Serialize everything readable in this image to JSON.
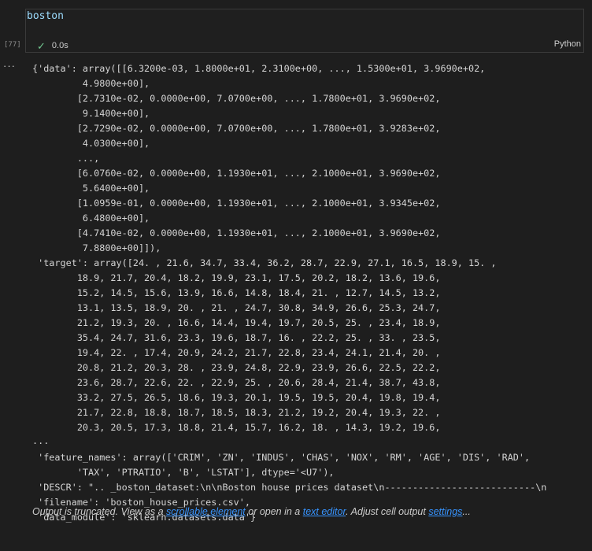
{
  "cell": {
    "code": "boston",
    "exec_count": "[77]",
    "duration": "0.0s",
    "language": "Python"
  },
  "output_menu_label": "···",
  "output_lines": [
    "{'data': array([[6.3200e-03, 1.8000e+01, 2.3100e+00, ..., 1.5300e+01, 3.9690e+02,",
    "         4.9800e+00],",
    "        [2.7310e-02, 0.0000e+00, 7.0700e+00, ..., 1.7800e+01, 3.9690e+02,",
    "         9.1400e+00],",
    "        [2.7290e-02, 0.0000e+00, 7.0700e+00, ..., 1.7800e+01, 3.9283e+02,",
    "         4.0300e+00],",
    "        ...,",
    "        [6.0760e-02, 0.0000e+00, 1.1930e+01, ..., 2.1000e+01, 3.9690e+02,",
    "         5.6400e+00],",
    "        [1.0959e-01, 0.0000e+00, 1.1930e+01, ..., 2.1000e+01, 3.9345e+02,",
    "         6.4800e+00],",
    "        [4.7410e-02, 0.0000e+00, 1.1930e+01, ..., 2.1000e+01, 3.9690e+02,",
    "         7.8800e+00]]),",
    " 'target': array([24. , 21.6, 34.7, 33.4, 36.2, 28.7, 22.9, 27.1, 16.5, 18.9, 15. ,",
    "        18.9, 21.7, 20.4, 18.2, 19.9, 23.1, 17.5, 20.2, 18.2, 13.6, 19.6,",
    "        15.2, 14.5, 15.6, 13.9, 16.6, 14.8, 18.4, 21. , 12.7, 14.5, 13.2,",
    "        13.1, 13.5, 18.9, 20. , 21. , 24.7, 30.8, 34.9, 26.6, 25.3, 24.7,",
    "        21.2, 19.3, 20. , 16.6, 14.4, 19.4, 19.7, 20.5, 25. , 23.4, 18.9,",
    "        35.4, 24.7, 31.6, 23.3, 19.6, 18.7, 16. , 22.2, 25. , 33. , 23.5,",
    "        19.4, 22. , 17.4, 20.9, 24.2, 21.7, 22.8, 23.4, 24.1, 21.4, 20. ,",
    "        20.8, 21.2, 20.3, 28. , 23.9, 24.8, 22.9, 23.9, 26.6, 22.5, 22.2,",
    "        23.6, 28.7, 22.6, 22. , 22.9, 25. , 20.6, 28.4, 21.4, 38.7, 43.8,",
    "        33.2, 27.5, 26.5, 18.6, 19.3, 20.1, 19.5, 19.5, 20.4, 19.8, 19.4,",
    "        21.7, 22.8, 18.8, 18.7, 18.5, 18.3, 21.2, 19.2, 20.4, 19.3, 22. ,",
    "        20.3, 20.5, 17.3, 18.8, 21.4, 15.7, 16.2, 18. , 14.3, 19.2, 19.6,"
  ],
  "ellipsis": "...",
  "output_lines_2": [
    " 'feature_names': array(['CRIM', 'ZN', 'INDUS', 'CHAS', 'NOX', 'RM', 'AGE', 'DIS', 'RAD',",
    "        'TAX', 'PTRATIO', 'B', 'LSTAT'], dtype='<U7'),",
    " 'DESCR': \".. _boston_dataset:\\n\\nBoston house prices dataset\\n---------------------------\\n",
    " 'filename': 'boston_house_prices.csv',",
    " 'data_module': 'sklearn.datasets.data'}"
  ],
  "truncation": {
    "prefix": "Output is truncated. View as a ",
    "link1": "scrollable element",
    "middle": " or open in a ",
    "link2": "text editor",
    "middle2": ". Adjust cell output ",
    "link3": "settings",
    "suffix": "..."
  }
}
